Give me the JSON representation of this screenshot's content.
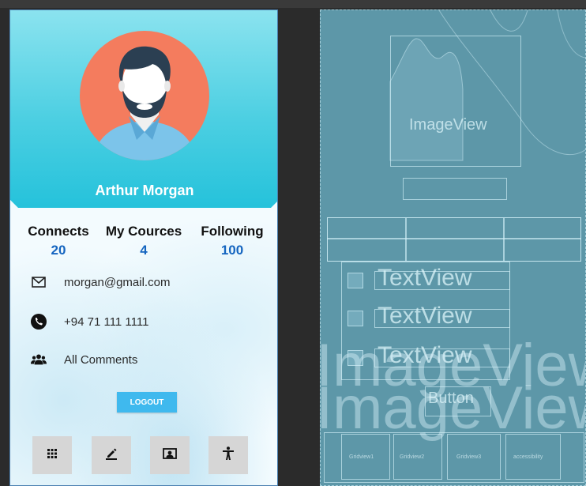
{
  "profile": {
    "name": "Arthur Morgan"
  },
  "stats": [
    {
      "label": "Connects",
      "value": "20"
    },
    {
      "label": "My Cources",
      "value": "4"
    },
    {
      "label": "Following",
      "value": "100"
    }
  ],
  "contact": {
    "email": "morgan@gmail.com",
    "phone": "+94 71 111 1111",
    "comments": "All Comments"
  },
  "logout_label": "LOGOUT",
  "bottom_nav": [
    {
      "icon": "grid-icon"
    },
    {
      "icon": "edit-icon"
    },
    {
      "icon": "id-card-icon"
    },
    {
      "icon": "accessibility-icon"
    }
  ],
  "blueprint": {
    "image_label": "ImageView",
    "textview_label": "TextView",
    "button_label": "Button",
    "watermark": "ImageView",
    "nav_labels": [
      "Gridview1",
      "Gridview2",
      "Gridview3",
      "accessibility"
    ]
  },
  "colors": {
    "header_top": "#8be3ef",
    "header_bottom": "#25c2db",
    "stat_value": "#1565c0",
    "logout": "#3fb9ee",
    "blueprint": "#5d97a8"
  }
}
